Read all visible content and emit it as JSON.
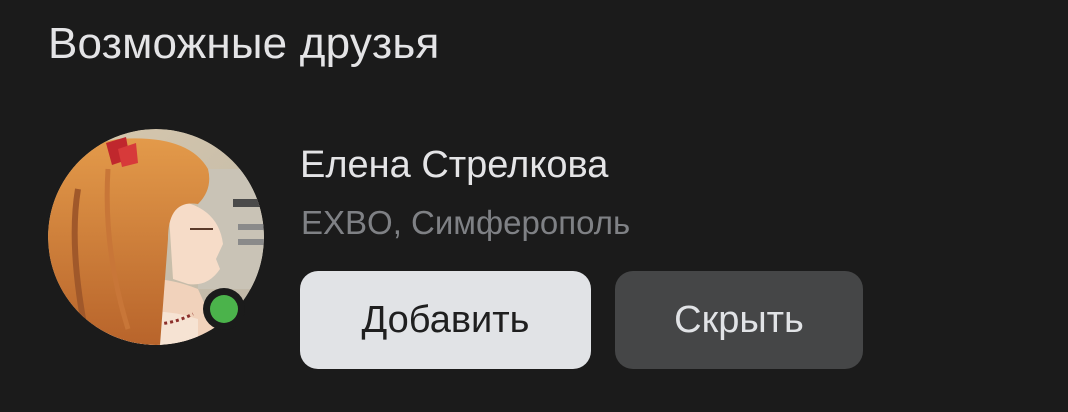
{
  "section": {
    "title": "Возможные друзья"
  },
  "suggestion": {
    "name": "Елена Стрелкова",
    "subtitle": "EXBO, Симферополь",
    "online": true,
    "avatar_icon": "user-avatar-photo",
    "add_label": "Добавить",
    "hide_label": "Скрыть"
  },
  "colors": {
    "background": "#1b1b1b",
    "primary_text": "#e4e4e6",
    "secondary_text": "#7f8185",
    "add_button_bg": "#e1e3e6",
    "hide_button_bg": "#454647",
    "online": "#4bb34b"
  }
}
